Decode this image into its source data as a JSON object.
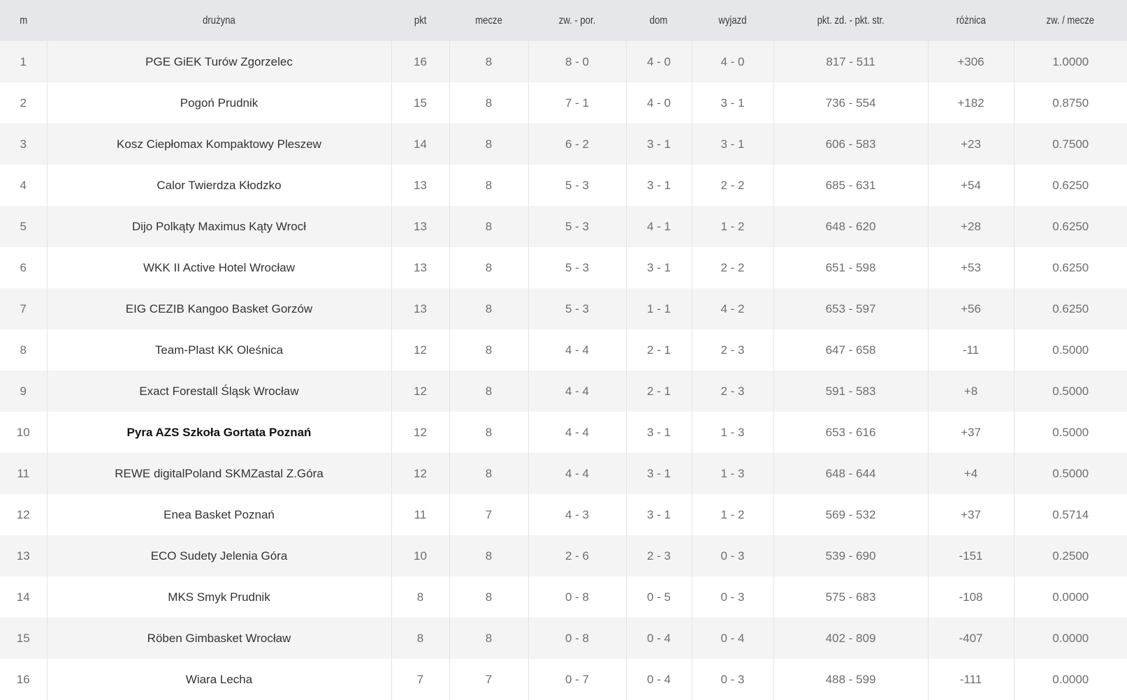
{
  "table": {
    "headers": [
      "m",
      "drużyna",
      "pkt",
      "mecze",
      "zw. - por.",
      "dom",
      "wyjazd",
      "pkt. zd. - pkt. str.",
      "różnica",
      "zw. / mecze"
    ],
    "highlight_team": "Pyra AZS Szkoła Gortata Poznań",
    "rows": [
      [
        "1",
        "PGE GiEK Turów Zgorzelec",
        "16",
        "8",
        "8 - 0",
        "4 - 0",
        "4 - 0",
        "817 - 511",
        "+306",
        "1.0000"
      ],
      [
        "2",
        "Pogoń Prudnik",
        "15",
        "8",
        "7 - 1",
        "4 - 0",
        "3 - 1",
        "736 - 554",
        "+182",
        "0.8750"
      ],
      [
        "3",
        "Kosz Ciepłomax Kompaktowy Pleszew",
        "14",
        "8",
        "6 - 2",
        "3 - 1",
        "3 - 1",
        "606 - 583",
        "+23",
        "0.7500"
      ],
      [
        "4",
        "Calor Twierdza Kłodzko",
        "13",
        "8",
        "5 - 3",
        "3 - 1",
        "2 - 2",
        "685 - 631",
        "+54",
        "0.6250"
      ],
      [
        "5",
        "Dijo Polkąty Maximus Kąty Wrocł",
        "13",
        "8",
        "5 - 3",
        "4 - 1",
        "1 - 2",
        "648 - 620",
        "+28",
        "0.6250"
      ],
      [
        "6",
        "WKK II Active Hotel Wrocław",
        "13",
        "8",
        "5 - 3",
        "3 - 1",
        "2 - 2",
        "651 - 598",
        "+53",
        "0.6250"
      ],
      [
        "7",
        "EIG CEZIB Kangoo Basket Gorzów",
        "13",
        "8",
        "5 - 3",
        "1 - 1",
        "4 - 2",
        "653 - 597",
        "+56",
        "0.6250"
      ],
      [
        "8",
        "Team-Plast KK Oleśnica",
        "12",
        "8",
        "4 - 4",
        "2 - 1",
        "2 - 3",
        "647 - 658",
        "-11",
        "0.5000"
      ],
      [
        "9",
        "Exact Forestall Śląsk Wrocław",
        "12",
        "8",
        "4 - 4",
        "2 - 1",
        "2 - 3",
        "591 - 583",
        "+8",
        "0.5000"
      ],
      [
        "10",
        "Pyra AZS Szkoła Gortata Poznań",
        "12",
        "8",
        "4 - 4",
        "3 - 1",
        "1 - 3",
        "653 - 616",
        "+37",
        "0.5000"
      ],
      [
        "11",
        "REWE digitalPoland SKMZastal Z.Góra",
        "12",
        "8",
        "4 - 4",
        "3 - 1",
        "1 - 3",
        "648 - 644",
        "+4",
        "0.5000"
      ],
      [
        "12",
        "Enea Basket Poznań",
        "11",
        "7",
        "4 - 3",
        "3 - 1",
        "1 - 2",
        "569 - 532",
        "+37",
        "0.5714"
      ],
      [
        "13",
        "ECO Sudety Jelenia Góra",
        "10",
        "8",
        "2 - 6",
        "2 - 3",
        "0 - 3",
        "539 - 690",
        "-151",
        "0.2500"
      ],
      [
        "14",
        "MKS Smyk Prudnik",
        "8",
        "8",
        "0 - 8",
        "0 - 5",
        "0 - 3",
        "575 - 683",
        "-108",
        "0.0000"
      ],
      [
        "15",
        "Röben Gimbasket Wrocław",
        "8",
        "8",
        "0 - 8",
        "0 - 4",
        "0 - 4",
        "402 - 809",
        "-407",
        "0.0000"
      ],
      [
        "16",
        "Wiara Lecha",
        "7",
        "7",
        "0 - 7",
        "0 - 4",
        "0 - 3",
        "488 - 599",
        "-111",
        "0.0000"
      ]
    ]
  }
}
